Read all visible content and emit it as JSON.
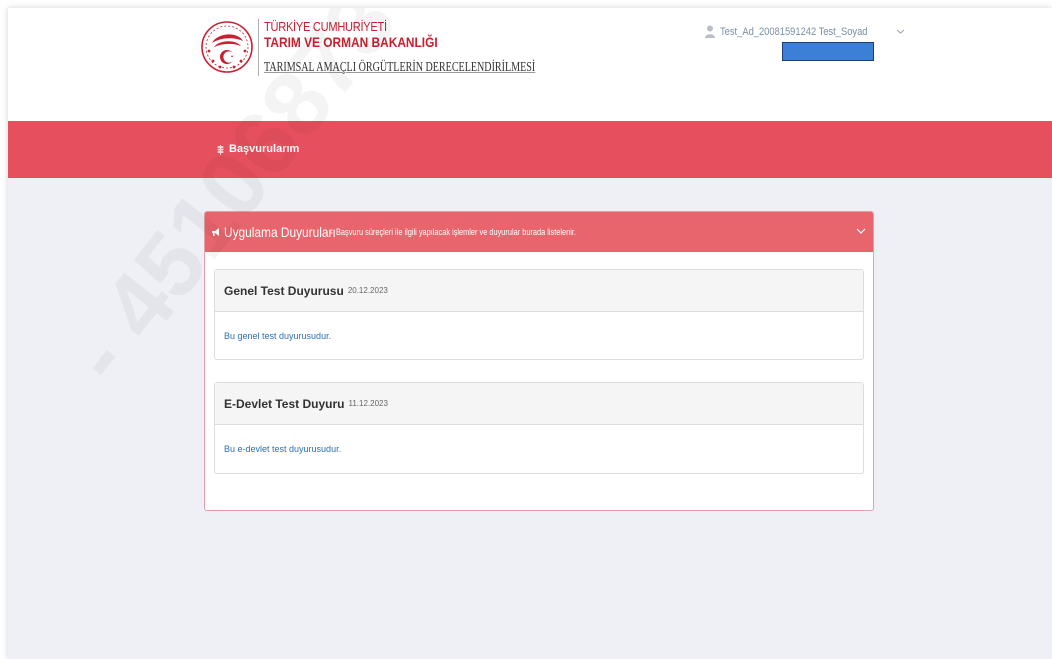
{
  "header": {
    "org_line1": "TÜRKİYE CUMHURİYETİ",
    "org_line2": "TARIM VE ORMAN BAKANLIĞI",
    "app_title": "TARIMSAL AMAÇLI ÖRGÜTLERİN DERECELENDİRİLMESİ",
    "emblem_icon": "ministry-emblem-icon"
  },
  "user": {
    "name": "Test_Ad_20081591242 Test_Soyad",
    "icon": "user-icon",
    "caret": "chevron-down-icon"
  },
  "nav": {
    "items": [
      {
        "label": "Başvurularım",
        "icon": "wheat-icon"
      }
    ]
  },
  "panel": {
    "title": "Uygulama Duyuruları",
    "separator": "-",
    "subtitle": "Başvuru süreçleri ile ilgili yapılacak işlemler ve duyurular burada listelenir.",
    "icon": "megaphone-icon",
    "toggle_icon": "chevron-down-icon",
    "announcements": [
      {
        "title": "Genel Test Duyurusu",
        "date": "20.12.2023",
        "body": "Bu genel test duyurusudur."
      },
      {
        "title": "E-Devlet Test Duyuru",
        "date": "11.12.2023",
        "body": "Bu e-devlet test duyurusudur."
      }
    ]
  },
  "watermark": "- 45106873 -",
  "colors": {
    "brand_red": "#c8202f",
    "navbar": "#e6505e",
    "panel_heading": "#e9656d",
    "link_blue": "#2c6fb3",
    "redaction_blue": "#3b7fd6",
    "page_bg": "#eef0f5"
  }
}
